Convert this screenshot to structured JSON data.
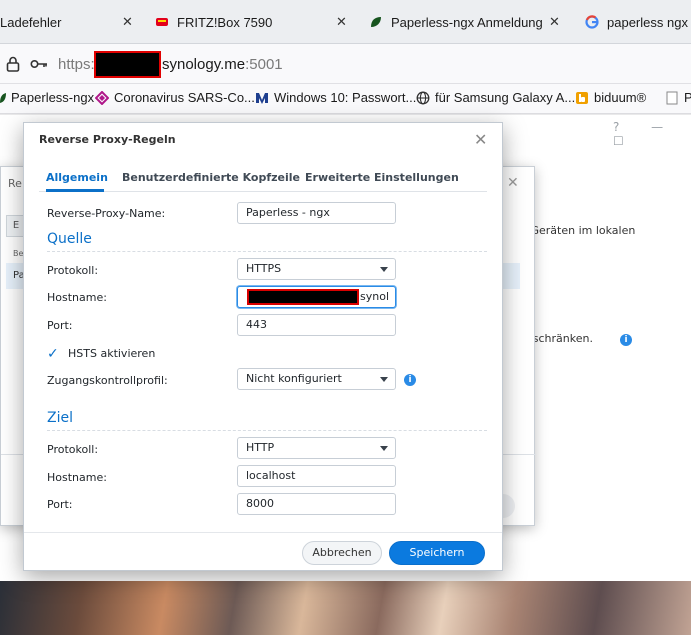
{
  "browser": {
    "tabs": [
      {
        "label": "Ladefehler"
      },
      {
        "label": "FRITZ!Box 7590"
      },
      {
        "label": "Paperless-ngx Anmeldung"
      },
      {
        "label": "paperless ngx ei"
      }
    ],
    "url": {
      "scheme": "https:",
      "host": "synology.me",
      "port": ":5001"
    },
    "bookmarks": [
      {
        "label": "Paperless-ngx"
      },
      {
        "label": "Coronavirus SARS-Co..."
      },
      {
        "label": "Windows 10: Passwort..."
      },
      {
        "label": "für Samsung Galaxy A..."
      },
      {
        "label": "biduum®"
      },
      {
        "label": "Pr"
      }
    ]
  },
  "background": {
    "text1": "u Geräten im lokalen",
    "text2": "zuschränken.",
    "top_icons": "? — ☐"
  },
  "behind_window": {
    "title": "Re",
    "button": "E",
    "column": "Be",
    "row": "Pa"
  },
  "dialog": {
    "title": "Reverse Proxy-Regeln",
    "tabs": [
      "Allgemein",
      "Benutzerdefinierte Kopfzeile",
      "Erweiterte Einstellungen"
    ],
    "name_label": "Reverse-Proxy-Name:",
    "name_value": "Paperless - ngx",
    "source": {
      "heading": "Quelle",
      "protocol_label": "Protokoll:",
      "protocol_value": "HTTPS",
      "hostname_label": "Hostname:",
      "hostname_suffix": "synol",
      "port_label": "Port:",
      "port_value": "443",
      "hsts_label": "HSTS aktivieren",
      "access_label": "Zugangskontrollprofil:",
      "access_value": "Nicht konfiguriert"
    },
    "target": {
      "heading": "Ziel",
      "protocol_label": "Protokoll:",
      "protocol_value": "HTTP",
      "hostname_label": "Hostname:",
      "hostname_value": "localhost",
      "port_label": "Port:",
      "port_value": "8000"
    },
    "buttons": {
      "cancel": "Abbrechen",
      "save": "Speichern"
    }
  },
  "colors": {
    "accent": "#0b70c8",
    "primary_button": "#0b7adf",
    "redaction_border": "#d90000"
  }
}
